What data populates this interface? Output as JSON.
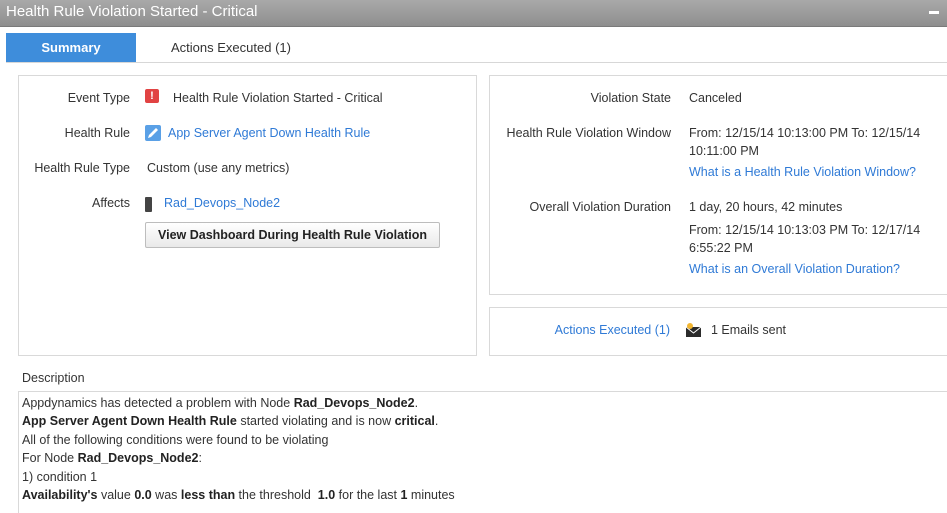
{
  "window": {
    "title": "Health Rule Violation Started - Critical"
  },
  "tabs": {
    "summary": "Summary",
    "actions_executed": "Actions Executed (1)"
  },
  "left_panel": {
    "event_type_label": "Event Type",
    "event_type_value": "Health Rule Violation Started - Critical",
    "health_rule_label": "Health Rule",
    "health_rule_value": "App Server Agent Down Health Rule",
    "health_rule_type_label": "Health Rule Type",
    "health_rule_type_value": "Custom (use any metrics)",
    "affects_label": "Affects",
    "affects_value": "Rad_Devops_Node2",
    "view_dashboard_button": "View Dashboard During Health Rule Violation"
  },
  "right_panel": {
    "violation_state_label": "Violation State",
    "violation_state_value": "Canceled",
    "window_label": "Health Rule Violation Window",
    "window_value_line1": "From: 12/15/14 10:13:00 PM To: 12/15/14",
    "window_value_line2": "10:11:00 PM",
    "window_help_link": "What is a Health Rule Violation Window?",
    "duration_label": "Overall Violation Duration",
    "duration_value": "1 day, 20 hours, 42 minutes",
    "duration_range_line1": "From: 12/15/14 10:13:03 PM To: 12/17/14",
    "duration_range_line2": "6:55:22 PM",
    "duration_help_link": "What is an Overall Violation Duration?"
  },
  "actions_panel": {
    "actions_link": "Actions Executed (1)",
    "emails_sent": "1 Emails sent"
  },
  "description": {
    "label": "Description",
    "l1_a": "Appdynamics has detected a problem with Node ",
    "l1_b": "Rad_Devops_Node2",
    "l1_c": ".",
    "l2_a": "App Server Agent Down Health Rule",
    "l2_b": " started violating and is now ",
    "l2_c": "critical",
    "l2_d": ".",
    "l3": "All of the following conditions were found to be violating",
    "l4_a": "For Node ",
    "l4_b": "Rad_Devops_Node2",
    "l4_c": ":",
    "l5": "1) condition 1",
    "l6_a": "Availability's",
    "l6_b": " value ",
    "l6_c": "0.0",
    "l6_d": " was ",
    "l6_e": "less than",
    "l6_f": " the threshold  ",
    "l6_g": "1.0",
    "l6_h": " for the last ",
    "l6_i": "1",
    "l6_j": " minutes"
  },
  "colors": {
    "accent": "#3e8ddb",
    "link": "#2f7ad6",
    "titlebar": "#9a9a9a",
    "critical": "#e14343"
  }
}
